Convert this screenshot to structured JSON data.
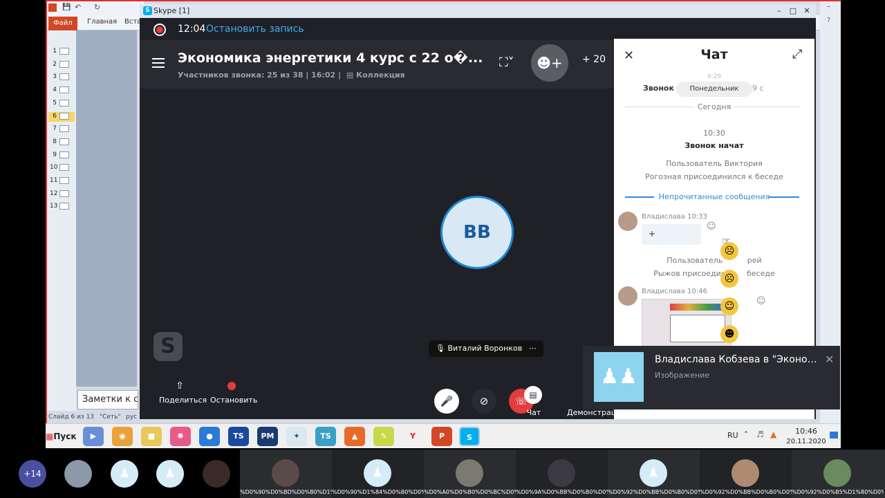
{
  "powerpoint": {
    "file_tab": "Файл",
    "tabs": [
      "Главная",
      "Вста"
    ],
    "slides": [
      "1",
      "2",
      "3",
      "4",
      "5",
      "6",
      "7",
      "8",
      "9",
      "10",
      "11",
      "12",
      "13"
    ],
    "active_slide": 6,
    "notes_text": "Заметки к с",
    "status": {
      "slide": "Слайд 6 из 13",
      "theme": "\"Сеть\"",
      "lang": "рус"
    }
  },
  "skype": {
    "window_title": "Skype [1]",
    "recording": {
      "time": "12:04",
      "stop_label": "Остановить запись"
    },
    "call": {
      "title": "Экономика энергетики 4 курс с 22 о�...",
      "subtitle": "Участников звонка: 25 из 38 | 16:02 |",
      "collection": "Коллекция",
      "plus_count": "+ 20"
    },
    "avatar_initials": "BB",
    "speaker_name": "Виталий Воронков",
    "controls": {
      "share": "Поделиться",
      "stop": "Остановить",
      "chat": "Чат",
      "demo": "Демонстраци"
    },
    "chat": {
      "title": "Чат",
      "cut_time": "9:29",
      "cut_text": "Звонок заве",
      "cut_text_tail": "9 с",
      "pill_monday": "Понедельник",
      "today": "Сегодня",
      "call_time": "10:30",
      "call_started": "Звонок начат",
      "join1_line1": "Пользователь Виктория",
      "join1_line2": "Рогозная присоединился к беседе",
      "unread": "Непрочитанные сообщения",
      "msg1_meta": "Владислава 10:33",
      "msg1_text": "+",
      "join2_line1": "Пользователь ",
      "join2_line1_tail": "рей",
      "join2_line2": "Рыжов присоедин",
      "join2_line2_tail": "беседе",
      "msg2_meta": "Владислава 10:46"
    },
    "toast": {
      "title": "Владислава Кобзева в \"Экономи...",
      "subtitle": "Изображение"
    }
  },
  "taskbar": {
    "start": "Пуск",
    "lang": "RU",
    "time": "10:46",
    "date": "20.11.2020"
  },
  "participants": {
    "more": "+14",
    "names": [
      "%D0%90%D0%BD%D0%B0%D1%81...",
      "%D0%90%D1%84%D0%B0%D0%B...",
      "%D0%A0%D0%B0%D0%BC%D0%B...",
      "%D0%9A%D0%BB%D0%B0%D0%B...",
      "%D0%92%D0%BB%D0%B0%D0%B...",
      "%D0%92%D0%BB%D0%B0%D0%B...",
      "%D0%92%D0%B5%D1%80%D0%B0..."
    ]
  },
  "colors": {
    "skype_blue": "#00aff0",
    "recording_red": "#e23c3c",
    "link_blue": "#3ea9ef"
  }
}
